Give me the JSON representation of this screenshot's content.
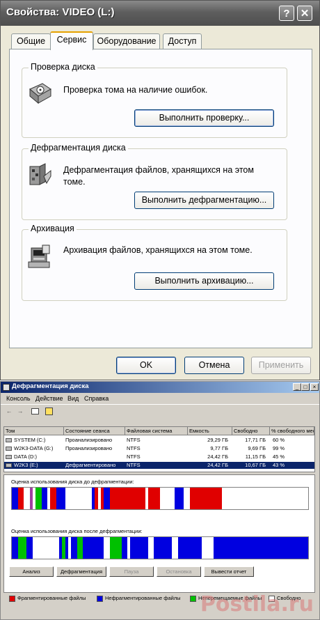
{
  "dialog": {
    "title": "Свойства: VIDEO (L:)",
    "help_label": "?",
    "close_label": "✕",
    "tabs": [
      {
        "label": "Общие"
      },
      {
        "label": "Сервис"
      },
      {
        "label": "Оборудование"
      },
      {
        "label": "Доступ"
      }
    ],
    "active_tab": "Сервис",
    "check": {
      "title": "Проверка диска",
      "text": "Проверка тома на наличие ошибок.",
      "button": "Выполнить проверку..."
    },
    "defrag": {
      "title": "Дефрагментация диска",
      "text_line1": "Дефрагментация файлов, хранящихся на этом",
      "text_line2": "томе.",
      "button": "Выполнить дефрагментацию..."
    },
    "backup": {
      "title": "Архивация",
      "text": "Архивация файлов, хранящихся на этом томе.",
      "button": "Выполнить архивацию..."
    },
    "ok": "OK",
    "cancel": "Отмена",
    "apply": "Применить"
  },
  "defrag_window": {
    "title": "Дефрагментация диска",
    "menu": [
      "Консоль",
      "Действие",
      "Вид",
      "Справка"
    ],
    "columns": [
      "Том",
      "Состояние сеанса",
      "Файловая система",
      "Емкость",
      "Свободно",
      "% свободного места"
    ],
    "rows": [
      {
        "vol": "SYSTEM (C:)",
        "state": "Проанализировано",
        "fs": "NTFS",
        "cap": "29,29 ГБ",
        "free": "17,71 ГБ",
        "pct": "60 %"
      },
      {
        "vol": "W2K3-DATA (G:)",
        "state": "Проанализировано",
        "fs": "NTFS",
        "cap": "9,77 ГБ",
        "free": "9,69 ГБ",
        "pct": "99 %"
      },
      {
        "vol": "DATA (D:)",
        "state": "",
        "fs": "NTFS",
        "cap": "24,42 ГБ",
        "free": "11,15 ГБ",
        "pct": "45 %"
      },
      {
        "vol": "W2K3 (E:)",
        "state": "Дефрагментировано",
        "fs": "NTFS",
        "cap": "24,42 ГБ",
        "free": "10,67 ГБ",
        "pct": "43 %"
      }
    ],
    "selected_row": 3,
    "before_label": "Оценка использования диска до дефрагментации:",
    "after_label": "Оценка использования диска после дефрагментации:",
    "buttons": [
      "Анализ",
      "Дефрагментация",
      "Пауза",
      "Остановка",
      "Вывести отчет"
    ],
    "legend": [
      {
        "label": "Фрагментированные файлы",
        "color": "#e00000"
      },
      {
        "label": "Нефрагментированные файлы",
        "color": "#0000e0"
      },
      {
        "label": "Неперемещаемые файлы",
        "color": "#00c000"
      },
      {
        "label": "Свободно",
        "color": "#ffffff"
      }
    ]
  },
  "watermark": "Postila.ru"
}
